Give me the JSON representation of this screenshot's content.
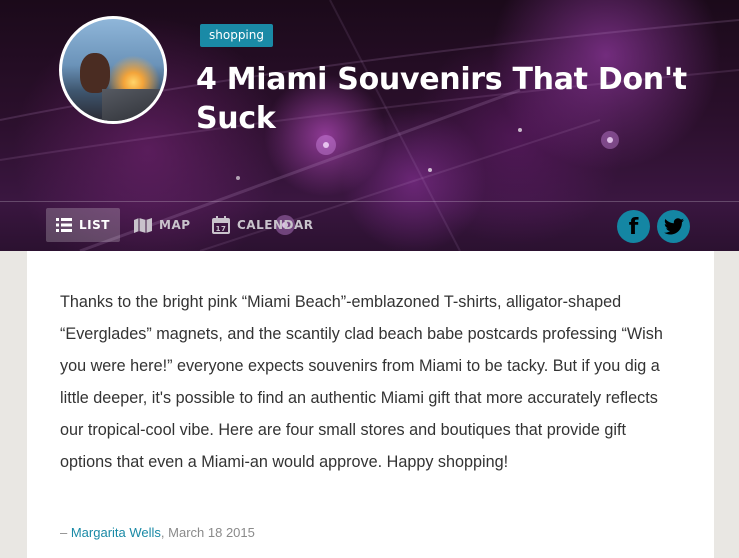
{
  "header": {
    "tag": "shopping",
    "title": "4 Miami Souvenirs That Don't Suck"
  },
  "nav": {
    "items": [
      {
        "label": "LIST",
        "icon": "list-icon",
        "active": true
      },
      {
        "label": "MAP",
        "icon": "map-icon",
        "active": false
      },
      {
        "label": "CALENDAR",
        "icon": "calendar-icon",
        "active": false
      }
    ],
    "calendar_icon_number": "17"
  },
  "social": {
    "facebook_glyph": "f",
    "twitter_icon": "twitter-bird-icon"
  },
  "article": {
    "body": "Thanks to the bright pink “Miami Beach”-emblazoned T-shirts, alligator-shaped “Everglades” magnets, and the scantily clad beach babe postcards professing “Wish you were here!” everyone expects souvenirs from Miami to be tacky. But if you dig a little deeper, it's possible to find an authentic Miami gift that more accurately reflects our tropical-cool vibe. Here are four small stores and boutiques that provide gift options that even a Miami-an would approve. Happy shopping!",
    "byline_prefix": "– ",
    "author": "Margarita Wells",
    "date": "March 18 2015"
  },
  "colors": {
    "accent": "#1a8aa6",
    "social": "#1486a3",
    "hero_dark": "#2a0f2b",
    "body_text": "#333333"
  }
}
